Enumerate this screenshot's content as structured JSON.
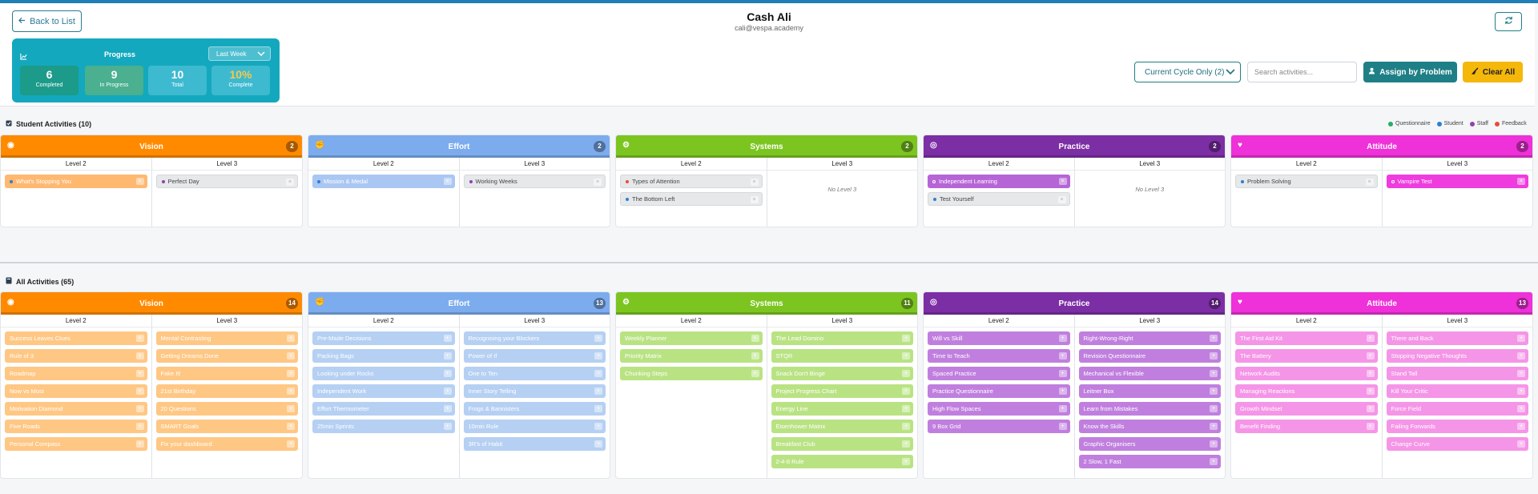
{
  "header": {
    "back_label": "Back to List",
    "name": "Cash Ali",
    "email": "cali@vespa.academy"
  },
  "progress": {
    "title": "Progress",
    "period": "Last Week",
    "stats": [
      {
        "value": "6",
        "label": "Completed"
      },
      {
        "value": "9",
        "label": "In Progress"
      },
      {
        "value": "10",
        "label": "Total"
      },
      {
        "value": "10%",
        "label": "Complete"
      }
    ]
  },
  "toolbar": {
    "filter": "Current Cycle Only (2)",
    "search_placeholder": "Search activities...",
    "assign_label": "Assign by Problem",
    "clear_label": "Clear All"
  },
  "student_section": {
    "title": "Student Activities (10)",
    "legend": [
      {
        "label": "Questionnaire",
        "color": "#27ae60"
      },
      {
        "label": "Student",
        "color": "#2d7fd3"
      },
      {
        "label": "Staff",
        "color": "#8e44ad"
      },
      {
        "label": "Feedback",
        "color": "#e74c3c"
      }
    ],
    "level2_label": "Level 2",
    "level3_label": "Level 3",
    "no_level3": "No Level 3",
    "categories": [
      {
        "name": "Vision",
        "count": "2",
        "level2": [
          {
            "label": "What's Stopping You",
            "dot": "#2d7fd3"
          }
        ],
        "level3": [
          {
            "label": "Perfect Day",
            "dot": "#8e44ad"
          }
        ]
      },
      {
        "name": "Effort",
        "count": "2",
        "level2": [
          {
            "label": "Mission & Medal",
            "dot": "#2d7fd3"
          }
        ],
        "level3": [
          {
            "label": "Working Weeks",
            "dot": "#8e44ad"
          }
        ]
      },
      {
        "name": "Systems",
        "count": "2",
        "level2": [
          {
            "label": "Types of Attention",
            "dot": "#e74c3c"
          },
          {
            "label": "The Bottom Left",
            "dot": "#2d7fd3"
          }
        ],
        "level3": []
      },
      {
        "name": "Practice",
        "count": "2",
        "level2": [
          {
            "label": "Independent Learning",
            "dot": "#ffffff"
          },
          {
            "label": "Test Yourself",
            "dot": "#2d7fd3"
          }
        ],
        "level3": []
      },
      {
        "name": "Attitude",
        "count": "2",
        "level2": [
          {
            "label": "Problem Solving",
            "dot": "#2d7fd3"
          }
        ],
        "level3": [
          {
            "label": "Vampire Test",
            "dot": "#ffffff"
          }
        ]
      }
    ]
  },
  "all_section": {
    "title": "All Activities (65)",
    "categories": [
      {
        "name": "Vision",
        "count": "14",
        "level2": [
          "Success Leaves Clues",
          "Rule of 3",
          "Roadmap",
          "Now vs Most",
          "Motivation Diamond",
          "Five Roads",
          "Personal Compass"
        ],
        "level3": [
          "Mental Contrasting",
          "Getting Dreams Done",
          "Fake It!",
          "21st Birthday",
          "20 Questions",
          "SMART Goals",
          "Fix your dashboard"
        ]
      },
      {
        "name": "Effort",
        "count": "13",
        "level2": [
          "Pre-Made Decisions",
          "Packing Bags",
          "Looking under Rocks",
          "Independent Work",
          "Effort Thermometer",
          "25min Sprints"
        ],
        "level3": [
          "Recognising your Blockers",
          "Power of If",
          "One to Ten",
          "Inner Story Telling",
          "Frogs & Bannisters",
          "10min Rule",
          "3R's of Habit"
        ]
      },
      {
        "name": "Systems",
        "count": "11",
        "level2": [
          "Weekly Planner",
          "Priority Matrix",
          "Chunking Steps"
        ],
        "level3": [
          "The Lead Domino",
          "STQR",
          "Snack Don't Binge",
          "Project Progress Chart",
          "Energy Line",
          "Eisenhower Matrix",
          "Breakfast Club",
          "2-4-8 Rule"
        ]
      },
      {
        "name": "Practice",
        "count": "14",
        "level2": [
          "Will vs Skill",
          "Time to Teach",
          "Spaced Practice",
          "Practice Questionnaire",
          "High Flow Spaces",
          "9 Box Grid"
        ],
        "level3": [
          "Right-Wrong-Right",
          "Revision Questionnaire",
          "Mechanical vs Flexible",
          "Leitner Box",
          "Learn from Mistakes",
          "Know the Skills",
          "Graphic Organisers",
          "2 Slow, 1 Fast"
        ]
      },
      {
        "name": "Attitude",
        "count": "13",
        "level2": [
          "The First Aid Kit",
          "The Battery",
          "Network Audits",
          "Managing Reactions",
          "Growth Mindset",
          "Benefit Finding"
        ],
        "level3": [
          "There and Back",
          "Stopping Negative Thoughts",
          "Stand Tall",
          "Kill Your Critic",
          "Force Field",
          "Failing Forwards",
          "Change Curve"
        ]
      }
    ]
  },
  "colors": {
    "Vision": {
      "head": "#ff8a00",
      "pill": "#ffc784",
      "sel": "#ffb870"
    },
    "Effort": {
      "head": "#7cacee",
      "pill": "#b5d0f3",
      "sel": "#a9c7f2"
    },
    "Systems": {
      "head": "#7cc521",
      "pill": "#b9e383",
      "sel": "#b9e383"
    },
    "Practice": {
      "head": "#7c2ea5",
      "pill": "#c07fde",
      "sel": "#b665d6"
    },
    "Attitude": {
      "head": "#ee31d8",
      "pill": "#f595e7",
      "sel": "#ee3cde"
    }
  },
  "category_icons": {
    "Vision": "eye-icon",
    "Effort": "muscle-icon",
    "Systems": "gear-icon",
    "Practice": "target-icon",
    "Attitude": "heart-icon"
  }
}
